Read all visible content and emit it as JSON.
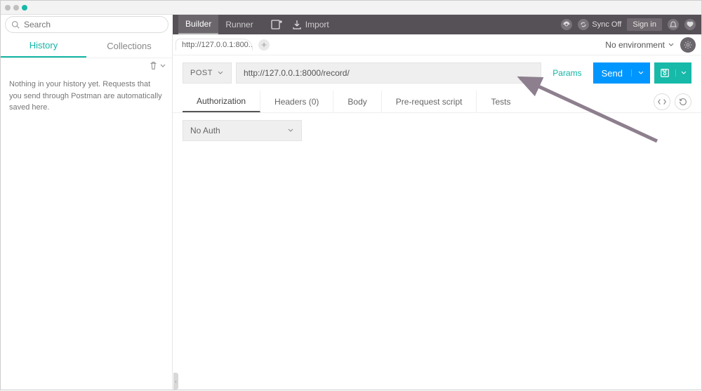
{
  "search": {
    "placeholder": "Search"
  },
  "topbar": {
    "builder": "Builder",
    "runner": "Runner",
    "import": "Import",
    "syncOff": "Sync Off",
    "signin": "Sign in"
  },
  "sidebar": {
    "tabs": {
      "history": "History",
      "collections": "Collections"
    },
    "emptyMsg": "Nothing in your history yet. Requests that you send through Postman are automatically saved here."
  },
  "request": {
    "tabLabel": "http://127.0.0.1:800...",
    "method": "POST",
    "url": "http://127.0.0.1:8000/record/",
    "params": "Params",
    "send": "Send",
    "envLabel": "No environment"
  },
  "subtabs": {
    "authorization": "Authorization",
    "headers": "Headers (0)",
    "body": "Body",
    "prerequest": "Pre-request script",
    "tests": "Tests"
  },
  "auth": {
    "selected": "No Auth"
  }
}
